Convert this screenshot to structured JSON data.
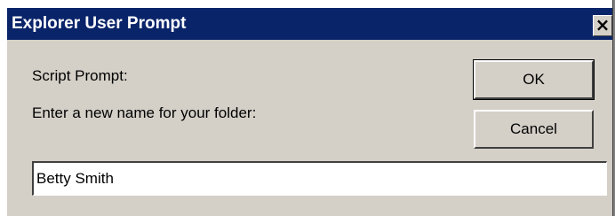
{
  "window": {
    "title": "Explorer User Prompt",
    "close_label": "×"
  },
  "prompt": {
    "header": "Script Prompt:",
    "message": "Enter a new name for your folder:"
  },
  "buttons": {
    "ok_label": "OK",
    "cancel_label": "Cancel"
  },
  "input": {
    "value": "Betty Smith"
  },
  "colors": {
    "title_bar": "#0a246a",
    "face": "#d4d0c8"
  },
  "icons": {
    "close": "close-icon"
  }
}
